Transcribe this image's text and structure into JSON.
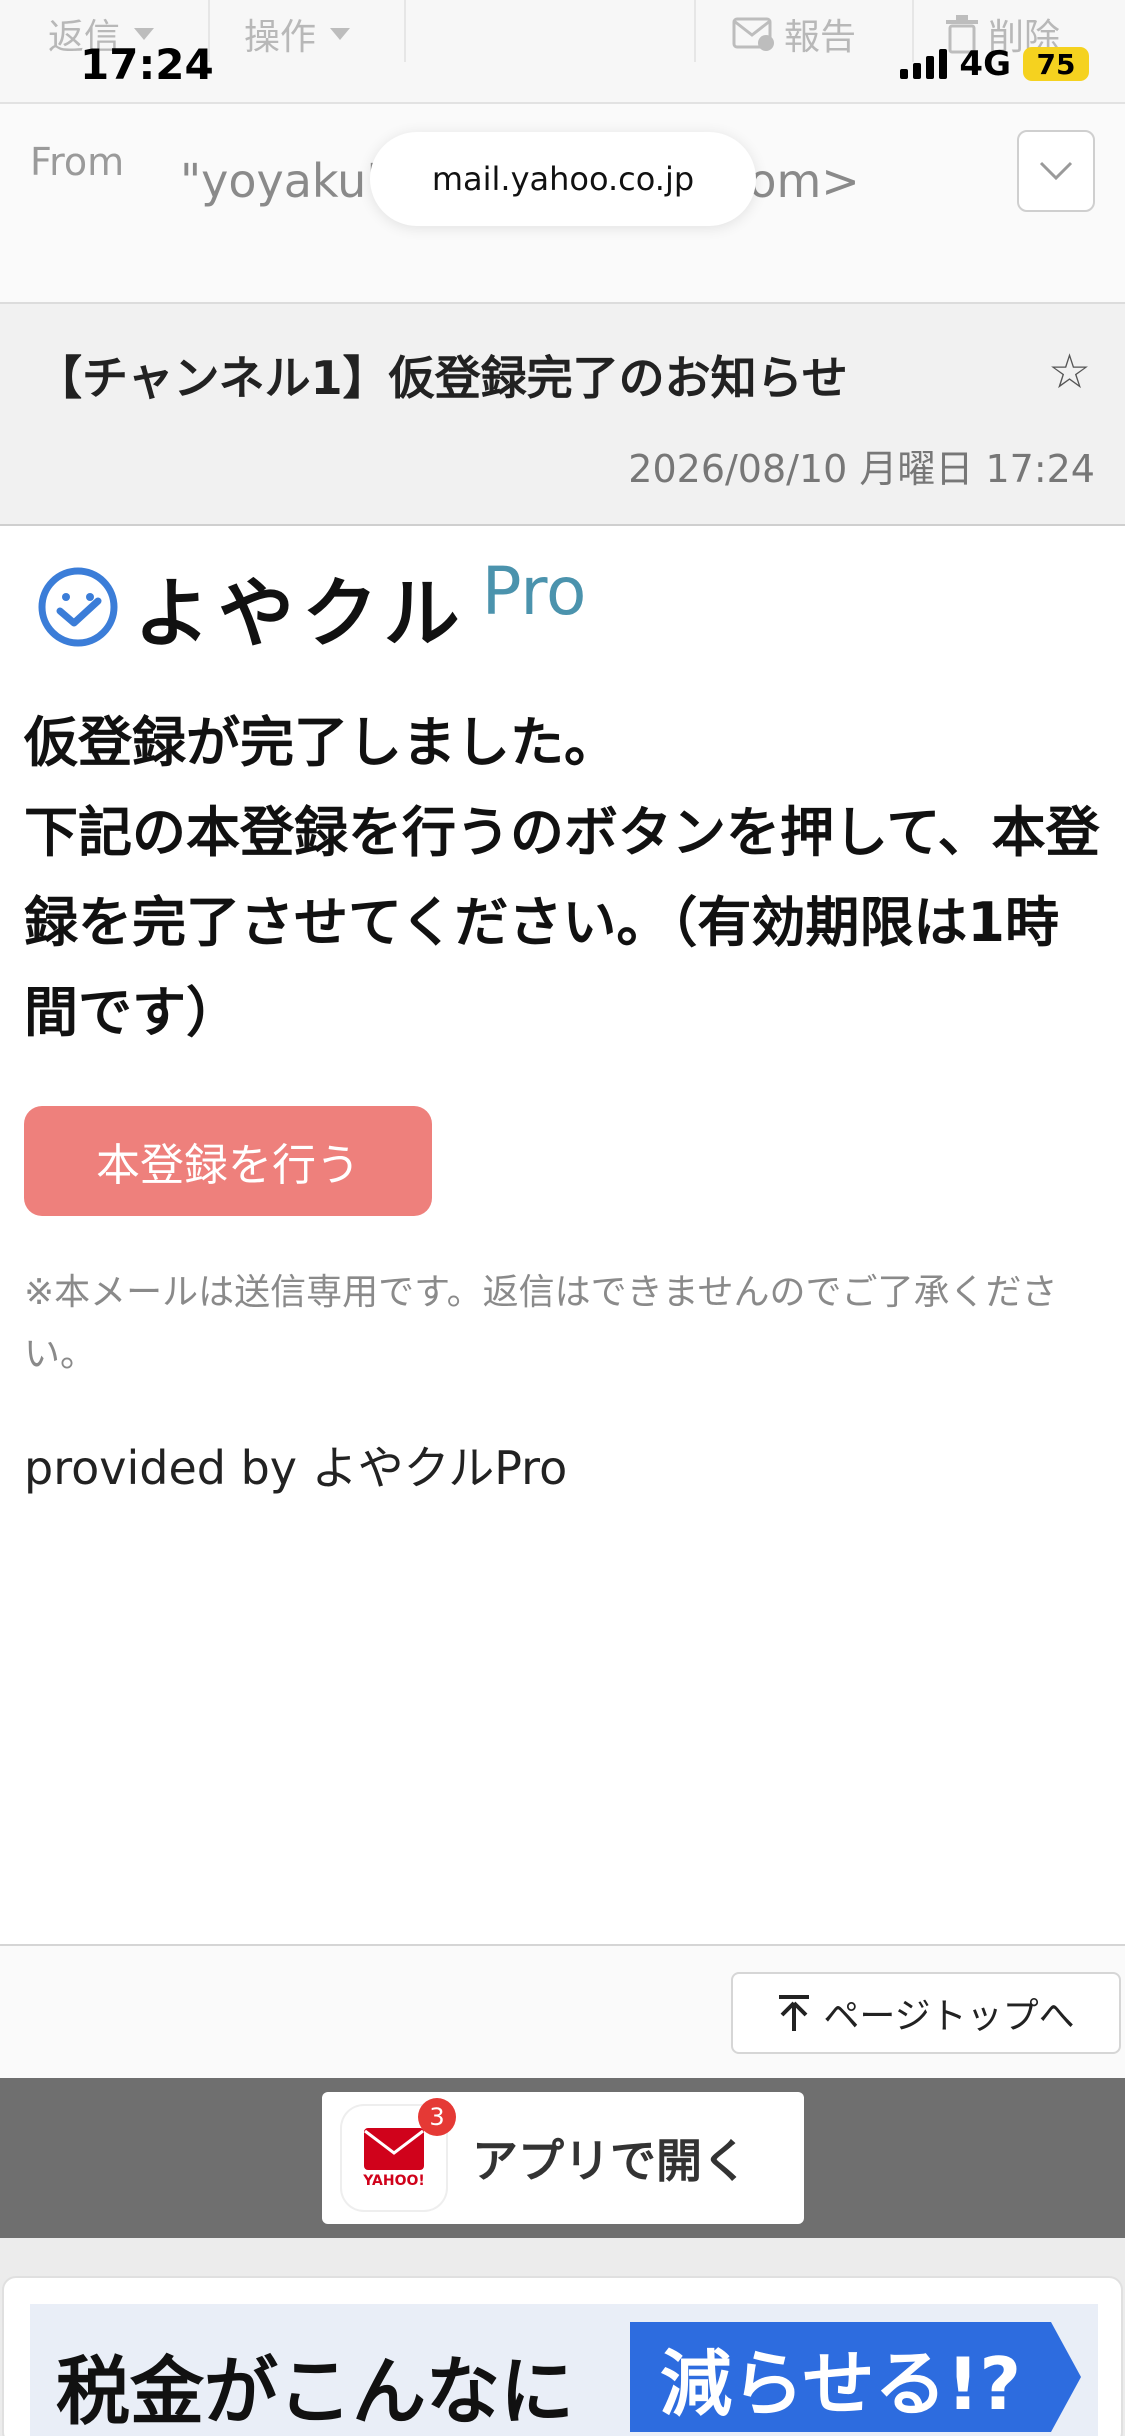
{
  "toolbar": {
    "reply_label": "返信",
    "actions_label": "操作",
    "report_label": "報告",
    "delete_label": "削除"
  },
  "status_bar": {
    "time": "17:24",
    "network": "4G",
    "battery": "75"
  },
  "header": {
    "from_label": "From",
    "from_value": "\"yoyaku\" <...@yoyakul.com>",
    "url": "mail.yahoo.co.jp"
  },
  "email": {
    "subject": "【チャンネル1】仮登録完了のお知らせ",
    "date": "2026/08/10 月曜日 17:24",
    "logo_text": "よやクル",
    "logo_pro": "Pro",
    "headline_1": "仮登録が完了しました。",
    "headline_2": "下記の本登録を行うのボタンを押して、本登録を完了させてください。（有効期限は1時間です）",
    "cta_label": "本登録を行う",
    "note": "※本メールは送信専用です。返信はできませんのでご了承ください。",
    "provided_by": "provided by よやクルPro"
  },
  "footer": {
    "page_top_label": "ページトップへ",
    "open_app_label": "アプリで開く",
    "app_badge": "3",
    "app_brand": "YAHOO!"
  },
  "ad": {
    "text": "税金がこんなに",
    "highlight": "減らせる!?"
  },
  "colors": {
    "cta": "#ee807c",
    "logo_check": "#3b7dd8",
    "logo_pro": "#4b93ad",
    "battery": "#f5d21f"
  }
}
